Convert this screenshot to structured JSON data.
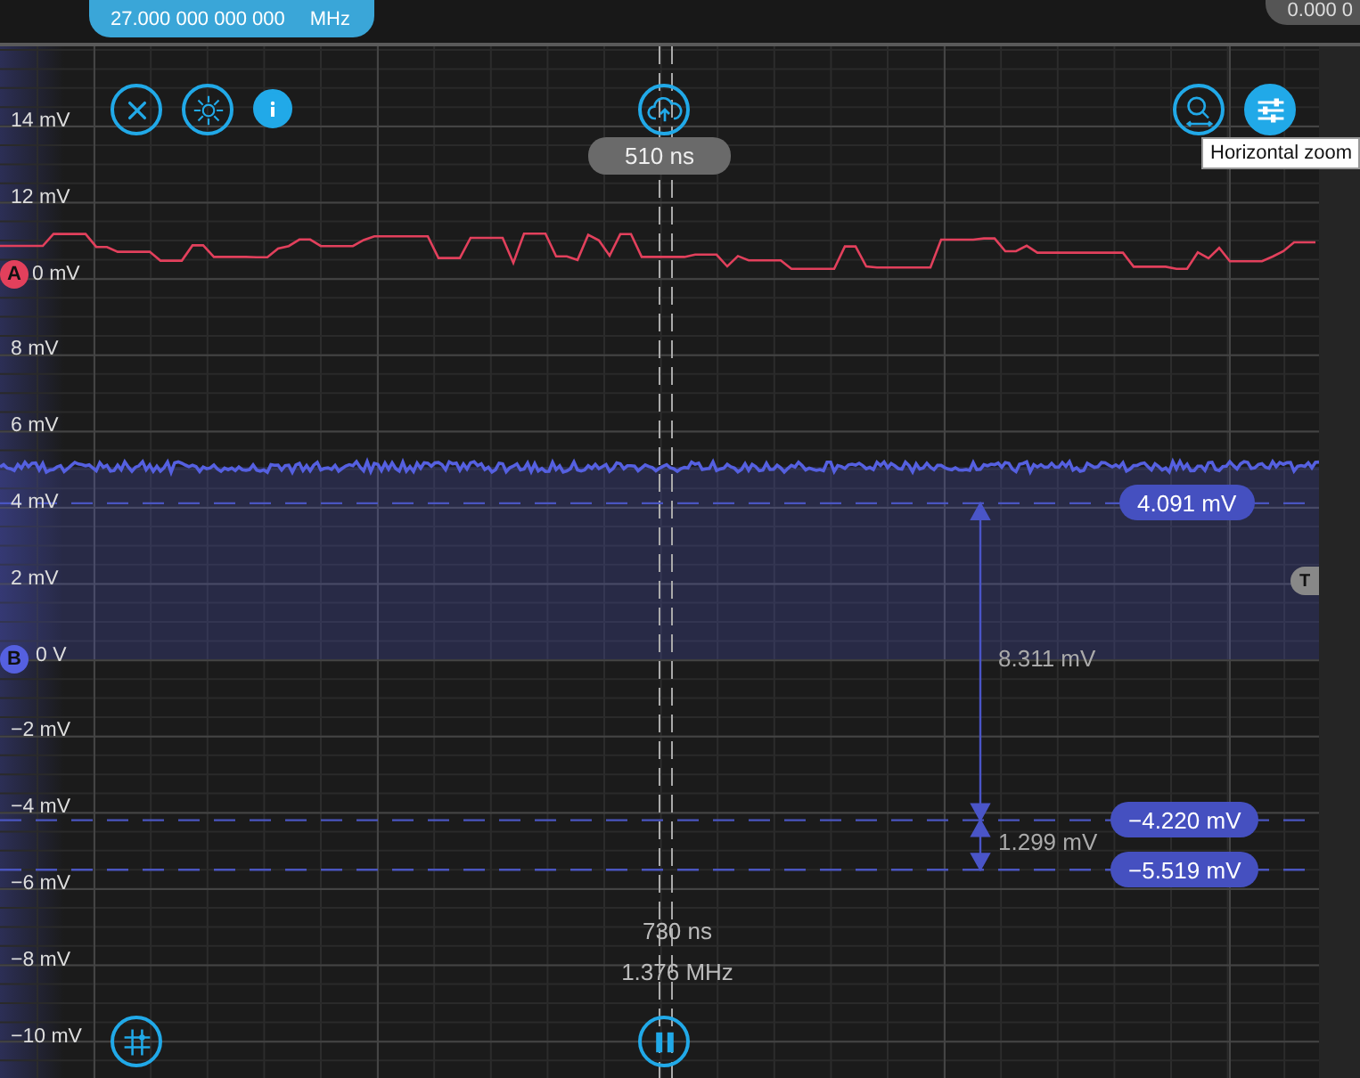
{
  "top_bar": {
    "frequency": {
      "value": "27.000 000 000 000",
      "unit": "MHz"
    },
    "readout": "0.000 0"
  },
  "y_axis": {
    "labels": [
      "14 mV",
      "12 mV",
      "0 mV",
      "8 mV",
      "6 mV",
      "4 mV",
      "2 mV",
      "0 V",
      "−2 mV",
      "−4 mV",
      "−6 mV",
      "−8 mV",
      "−10 mV"
    ]
  },
  "channels": [
    {
      "name": "A",
      "color": "#e2405c"
    },
    {
      "name": "B",
      "color": "#5560e0"
    }
  ],
  "trigger": {
    "label": "T"
  },
  "cursors": [
    {
      "value": "4.091 mV"
    },
    {
      "value": "−4.220 mV"
    },
    {
      "value": "−5.519 mV"
    }
  ],
  "deltas": [
    {
      "value": "8.311 mV"
    },
    {
      "value": "1.299 mV"
    }
  ],
  "time_cursor": {
    "top_label": "510 ns",
    "period": "730 ns",
    "frequency": "1.376 MHz"
  },
  "toolbar": [
    {
      "kind": "close",
      "active": false
    },
    {
      "kind": "burst",
      "active": false
    },
    {
      "kind": "info",
      "active": true
    },
    {
      "kind": "cloud",
      "active": false
    },
    {
      "kind": "zoom",
      "active": false
    },
    {
      "kind": "sliders",
      "active": true
    },
    {
      "kind": "grid",
      "active": false
    },
    {
      "kind": "pause",
      "active": false
    }
  ],
  "tooltip": "Horizontal zoom"
}
